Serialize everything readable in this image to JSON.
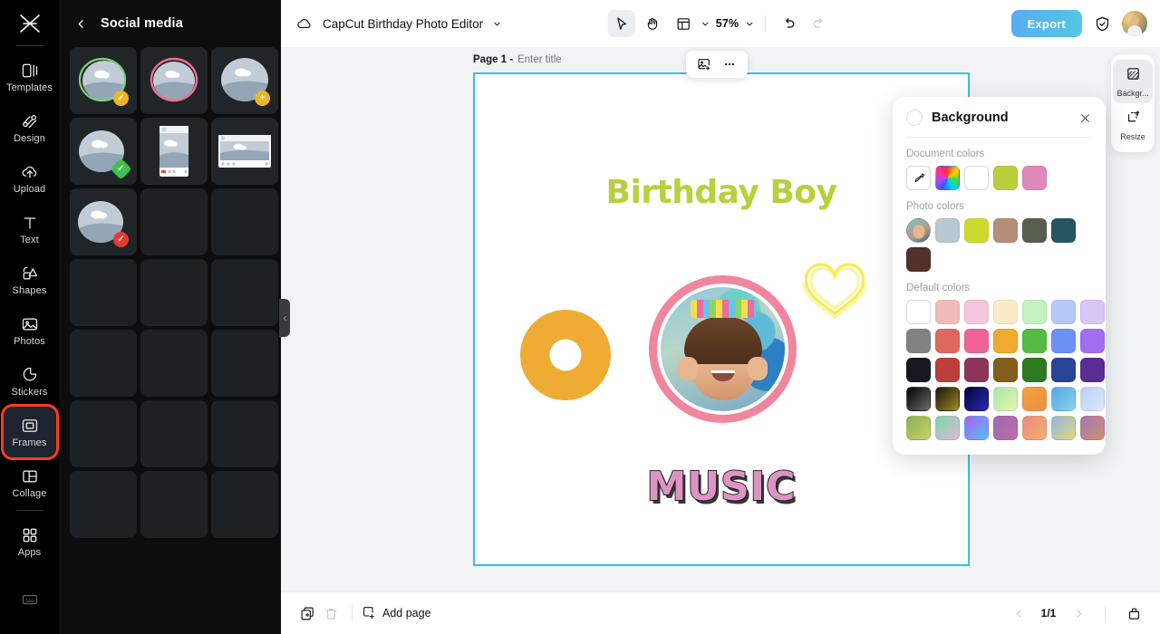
{
  "rail": {
    "logo_icon": "capcut-logo-icon",
    "items": [
      {
        "label": "Templates",
        "icon": "templates-icon",
        "active": false
      },
      {
        "label": "Design",
        "icon": "design-icon",
        "active": false
      },
      {
        "label": "Upload",
        "icon": "upload-icon",
        "active": false
      },
      {
        "label": "Text",
        "icon": "text-icon",
        "active": false
      },
      {
        "label": "Shapes",
        "icon": "shapes-icon",
        "active": false
      },
      {
        "label": "Photos",
        "icon": "photos-icon",
        "active": false
      },
      {
        "label": "Stickers",
        "icon": "stickers-icon",
        "active": false
      },
      {
        "label": "Frames",
        "icon": "frames-icon",
        "active": true
      },
      {
        "label": "Collage",
        "icon": "collage-icon",
        "active": false
      },
      {
        "label": "Apps",
        "icon": "apps-icon",
        "active": false
      }
    ],
    "highlight_label": "Frames",
    "highlight_color": "#ff3d14",
    "bottom_icon": "keyboard-shortcuts-icon"
  },
  "panel": {
    "title": "Social media",
    "back_icon": "chevron-left-icon",
    "collapse_icon": "chevron-left-icon",
    "frames": [
      {
        "kind": "circle-outline-green",
        "badge": "check",
        "badge_color": "#f0b429"
      },
      {
        "kind": "circle-outline-pink",
        "badge": null,
        "badge_color": null
      },
      {
        "kind": "circle-plain",
        "badge": "plus",
        "badge_color": "#f0b429"
      },
      {
        "kind": "circle-plain",
        "badge": "check",
        "badge_color": "#3fbf4f"
      },
      {
        "kind": "post-portrait",
        "badge": null,
        "badge_color": null
      },
      {
        "kind": "post-landscape",
        "badge": null,
        "badge_color": null
      },
      {
        "kind": "circle-plain",
        "badge": "check",
        "badge_color": "#e8392f"
      }
    ],
    "empty_cells": 14
  },
  "topbar": {
    "doc_icon": "cloud-saved-icon",
    "title": "CapCut Birthday Photo Editor",
    "title_caret_icon": "chevron-down-icon",
    "tools": [
      {
        "name": "select-tool",
        "icon": "cursor-arrow-icon",
        "selected": true
      },
      {
        "name": "hand-tool",
        "icon": "hand-icon",
        "selected": false
      },
      {
        "name": "layout-tool",
        "icon": "layout-panel-icon",
        "selected": false
      }
    ],
    "layout_caret_icon": "chevron-down-icon",
    "zoom_value": "57%",
    "zoom_caret_icon": "chevron-down-icon",
    "undo_icon": "undo-icon",
    "redo_icon": "redo-icon",
    "undo_enabled": true,
    "redo_enabled": false,
    "export_label": "Export",
    "shield_icon": "shield-check-icon",
    "avatar_icon": "user-avatar"
  },
  "canvas": {
    "page_label": "Page 1 -",
    "title_placeholder": "Enter title",
    "title_value": "",
    "floating_tools": [
      {
        "name": "replace-image-button",
        "icon": "image-plus-icon"
      },
      {
        "name": "more-options-button",
        "icon": "ellipsis-icon"
      }
    ],
    "border_color": "#35c0e8",
    "artwork": {
      "heading": "Birthday Boy",
      "heading_color": "#b9cf3e",
      "donut_color": "#eeac34",
      "photo_frame_color": "#f0859e",
      "heart_color": "#f5ec52",
      "music_text": "MUSIC",
      "music_color": "#dd93c6"
    }
  },
  "right_rail": {
    "items": [
      {
        "label": "Backgr...",
        "icon": "background-icon",
        "active": true
      },
      {
        "label": "Resize",
        "icon": "resize-icon",
        "active": false
      }
    ]
  },
  "background_panel": {
    "title": "Background",
    "close_icon": "close-icon",
    "sections": {
      "document": {
        "label": "Document colors",
        "eyedropper_icon": "eyedropper-icon",
        "swatches": [
          "rainbow-wheel",
          "#ffffff",
          "#b9cf3e",
          "#e089bb"
        ]
      },
      "photo": {
        "label": "Photo colors",
        "swatches": [
          "photo-thumbnail",
          "#b9c9d2",
          "#ccda2e",
          "#b68f78",
          "#585e4f",
          "#275663",
          "#53302a"
        ]
      },
      "default": {
        "label": "Default colors",
        "rows": [
          [
            "#ffffff",
            "#f0bcb8",
            "#f5c7dd",
            "#faeac6",
            "#c5f0c0",
            "#b6c8f7",
            "#d8c6f7"
          ],
          [
            "#828282",
            "#e0675f",
            "#f06497",
            "#eeab30",
            "#52bc44",
            "#6b91f7",
            "#a16ef0"
          ],
          [
            "#17181f",
            "#bb3f38",
            "#8e3458",
            "#82601b",
            "#2e7a1e",
            "#2b4396",
            "#5a2d95"
          ],
          [
            "grad-black",
            "grad-olive",
            "grad-navy",
            "grad-mint",
            "grad-orange",
            "grad-skyblue",
            "grad-lightblue"
          ],
          [
            "grad-olivegreen",
            "grad-tealpink",
            "grad-purpleblue",
            "grad-plum",
            "grad-coral",
            "grad-bluegold",
            "grad-mauve"
          ]
        ]
      }
    }
  },
  "bottombar": {
    "duplicate_icon": "duplicate-page-icon",
    "delete_icon": "trash-icon",
    "add_page_icon": "add-page-icon",
    "add_page_label": "Add page",
    "prev_icon": "chevron-left-icon",
    "next_icon": "chevron-right-icon",
    "pager": "1/1",
    "grid_view_icon": "page-grid-icon"
  }
}
